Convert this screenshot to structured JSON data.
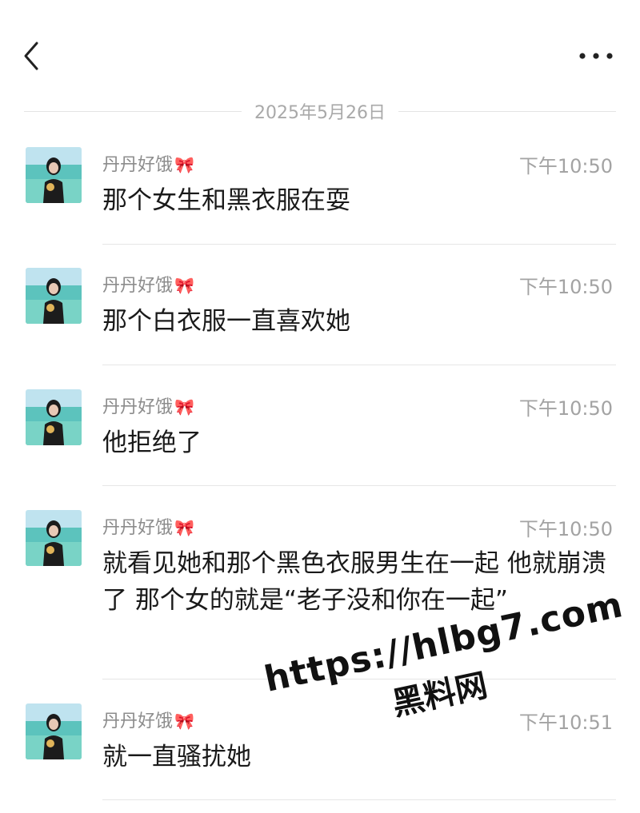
{
  "header": {
    "back_icon": "chevron-left-icon",
    "more_icon": "more-horizontal-icon"
  },
  "date_separator": "2025年5月26日",
  "messages": [
    {
      "sender": "丹丹好饿",
      "sender_emoji": "🎀",
      "time": "下午10:50",
      "text": "那个女生和黑衣服在耍"
    },
    {
      "sender": "丹丹好饿",
      "sender_emoji": "🎀",
      "time": "下午10:50",
      "text": "那个白衣服一直喜欢她"
    },
    {
      "sender": "丹丹好饿",
      "sender_emoji": "🎀",
      "time": "下午10:50",
      "text": "他拒绝了"
    },
    {
      "sender": "丹丹好饿",
      "sender_emoji": "🎀",
      "time": "下午10:50",
      "text": "就看见她和那个黑色衣服男生在一起 他就崩溃了 那个女的就是“老子没和你在一起”"
    },
    {
      "sender": "丹丹好饿",
      "sender_emoji": "🎀",
      "time": "下午10:51",
      "text": "就一直骚扰她"
    }
  ],
  "watermark": {
    "url": "https://hlbg7.com",
    "name": "黑料网"
  },
  "colors": {
    "background": "#ffffff",
    "meta_text": "#a3a3a3",
    "message_text": "#1a1a1a",
    "divider": "#e6e6e6"
  }
}
